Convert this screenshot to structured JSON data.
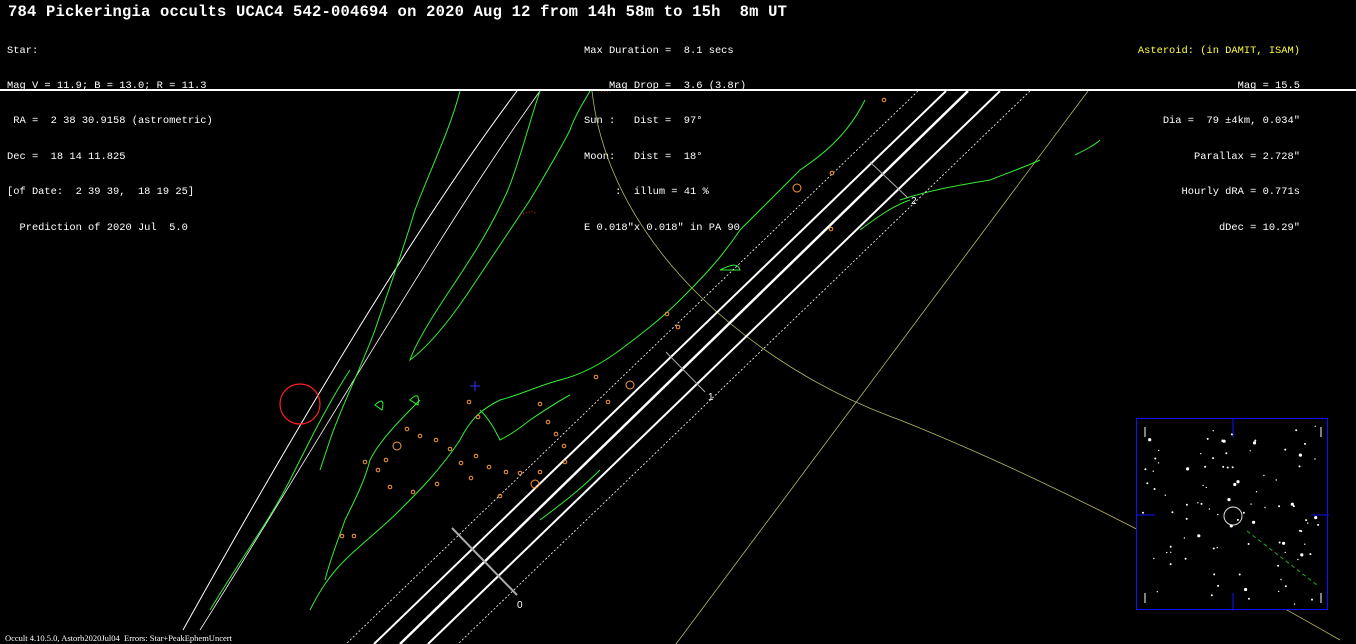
{
  "title": "784 Pickeringia occults UCAC4 542-004694 on 2020 Aug 12 from 14h 58m to 15h  8m UT",
  "star_block": {
    "lines": [
      "Star:",
      "Mag V = 11.9; B = 13.0; R = 11.3",
      " RA =  2 38 30.9158 (astrometric)",
      "Dec =  18 14 11.825",
      "[of Date:  2 39 39,  18 19 25]",
      "  Prediction of 2020 Jul  5.0"
    ]
  },
  "event_block": {
    "lines": [
      "Max Duration =  8.1 secs",
      "    Mag Drop =  3.6 (3.8r)",
      "Sun :   Dist =  97°",
      "Moon:   Dist =  18°",
      "     :  illum = 41 %",
      "E 0.018\"x 0.018\" in PA 90"
    ]
  },
  "asteroid_block": {
    "header": "Asteroid: (in DAMIT, ISAM)",
    "lines": [
      "Mag = 15.5",
      "Dia =  79 ±4km, 0.034\"",
      "Parallax = 2.728\"",
      "Hourly dRA = 0.771s",
      "dDec = 10.29\""
    ]
  },
  "footer": "Occult 4.10.5.0, Astorb2020Jul04  Errors: Star+PeakEphemUncert",
  "time_ticks": [
    "0",
    "1",
    "2"
  ],
  "colors": {
    "background": "#000000",
    "coastline": "#33ee33",
    "path_line": "#ffffff",
    "twilight_line": "#c8c870",
    "city_marker": "#ff9933",
    "sun_circle": "#ff2020",
    "moon_cross": "#3333ff",
    "inset_border": "#1010ff",
    "header_accent": "#ffff44"
  }
}
